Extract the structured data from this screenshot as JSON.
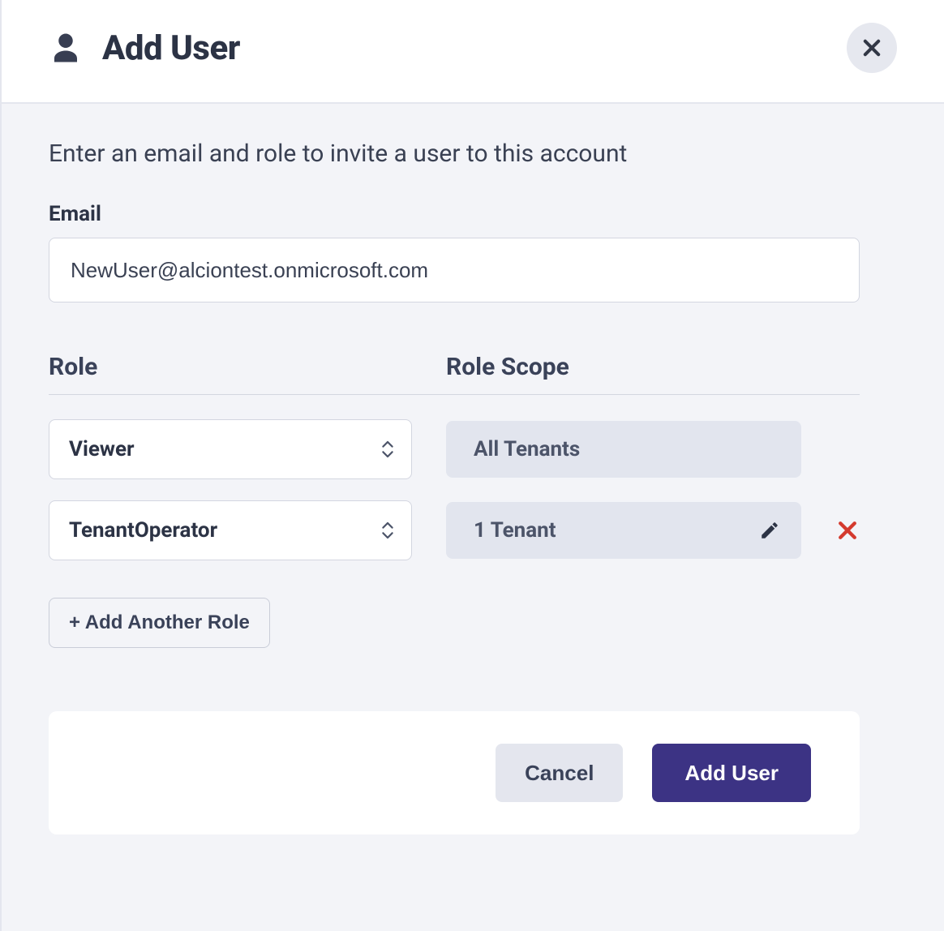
{
  "header": {
    "title": "Add User"
  },
  "form": {
    "instruction": "Enter an email and role to invite a user to this account",
    "email_label": "Email",
    "email_value": "NewUser@alciontest.onmicrosoft.com",
    "role_header": "Role",
    "scope_header": "Role Scope",
    "roles": [
      {
        "role": "Viewer",
        "scope": "All Tenants",
        "editable": false,
        "removable": false
      },
      {
        "role": "TenantOperator",
        "scope": "1 Tenant",
        "editable": true,
        "removable": true
      }
    ],
    "add_role_label": "+ Add Another Role"
  },
  "footer": {
    "cancel_label": "Cancel",
    "submit_label": "Add User"
  }
}
